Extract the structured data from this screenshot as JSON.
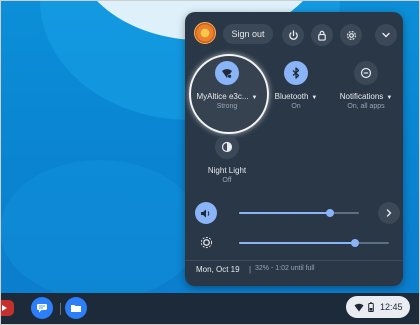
{
  "panel": {
    "sign_out_label": "Sign out",
    "buttons": [
      "power-icon",
      "lock-icon",
      "gear-icon",
      "chevron-down-icon"
    ]
  },
  "features": [
    {
      "label": "MyAltice e3c...",
      "sublabel": "Strong",
      "icon": "wifi-icon",
      "state": "on"
    },
    {
      "label": "Bluetooth",
      "sublabel": "On",
      "icon": "bluetooth-icon",
      "state": "on"
    },
    {
      "label": "Notifications",
      "sublabel": "On, all apps",
      "icon": "notifications-icon",
      "state": "off"
    },
    {
      "label": "Night Light",
      "sublabel": "Off",
      "icon": "night-light-icon",
      "state": "off"
    }
  ],
  "sliders": {
    "volume": {
      "level": 0.76,
      "icon": "volume-icon"
    },
    "brightness": {
      "level": 0.77,
      "icon": "brightness-icon"
    }
  },
  "footer": {
    "date": "Mon, Oct 19",
    "separator": "|",
    "battery": "32% - 1:02 until full"
  },
  "shelf": {
    "apps": [
      "youtube-icon",
      "messages-icon",
      "files-icon"
    ],
    "time": "12:45"
  },
  "colors": {
    "panel_bg": "#2a3746",
    "accent": "#8ab4f8",
    "desktop": "#0b86d2"
  }
}
